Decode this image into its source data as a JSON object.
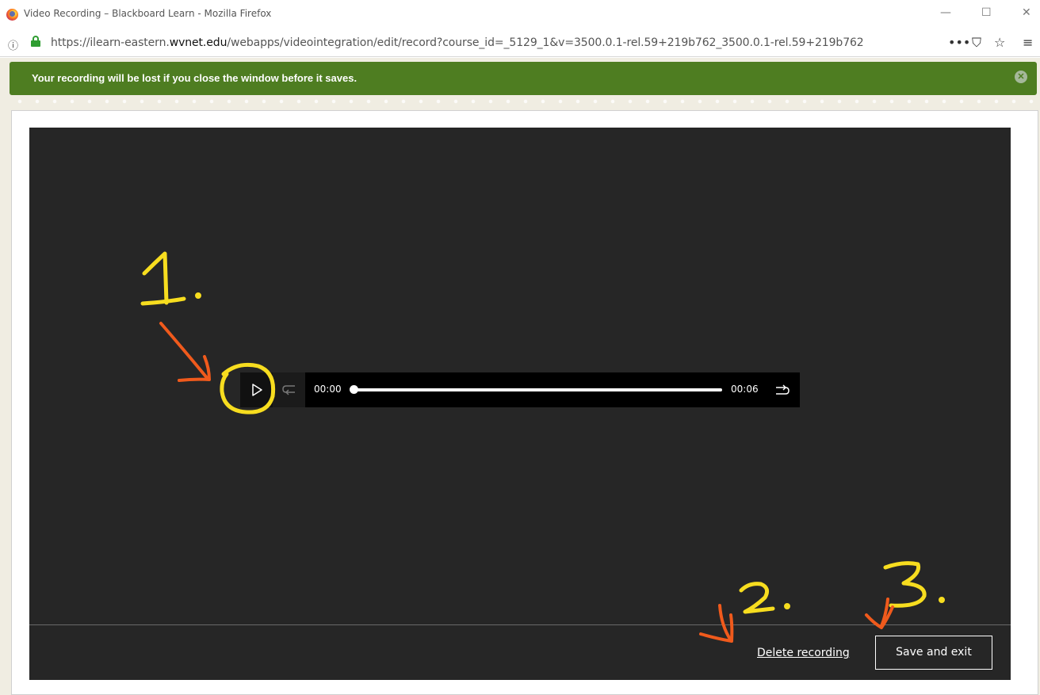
{
  "window": {
    "title": "Video Recording – Blackboard Learn - Mozilla Firefox",
    "controls": {
      "minimize": "—",
      "maximize": "☐",
      "close": "✕"
    }
  },
  "addressbar": {
    "url_prefix": "https://ilearn-eastern.",
    "url_domain": "wvnet.edu",
    "url_path": "/webapps/videointegration/edit/record?course_id=_5129_1&v=3500.0.1-rel.59+219b762_3500.0.1-rel.59+219b762",
    "icons": [
      "info-icon",
      "lock-icon",
      "more-icon",
      "pocket-icon",
      "bookmark-star-icon",
      "menu-icon"
    ],
    "more": "•••",
    "pocket": "⛉",
    "star": "☆",
    "menu": "≡"
  },
  "notice": {
    "text": "Your recording will be lost if you close the window before it saves.",
    "color": "#4e7d21"
  },
  "player": {
    "current_time": "00:00",
    "duration": "00:06",
    "progress": 0
  },
  "footer": {
    "delete_label": "Delete recording",
    "save_label": "Save and exit"
  },
  "annotations": {
    "step1": "1.",
    "step2": "2.",
    "step3": "3.",
    "marker_color": "#f7dd1f",
    "arrow_color": "#f05a1c"
  }
}
